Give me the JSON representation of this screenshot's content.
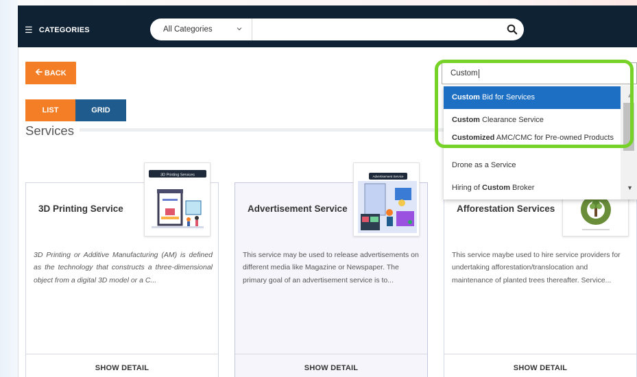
{
  "header": {
    "categories_label": "CATEGORIES",
    "category_select_value": "All Categories",
    "search_value": ""
  },
  "back_label": "BACK",
  "view_toggle": {
    "list_label": "LIST",
    "grid_label": "GRID"
  },
  "section_title": "Services",
  "autocomplete": {
    "input_value": "Custom",
    "items": [
      {
        "bold": "Custom",
        "rest": " Bid for Services"
      },
      {
        "bold": "Custom",
        "rest": " Clearance Service"
      },
      {
        "bold": "Customized",
        "rest": " AMC/CMC for Pre-owned Products"
      },
      {
        "bold": "",
        "rest": "Drone as a Service"
      },
      {
        "pre": "Hiring of ",
        "bold": "Custom",
        "rest": " Broker"
      }
    ]
  },
  "cards": [
    {
      "title": "3D Printing Service",
      "thumb_label": "3D Printing Services",
      "description": "3D Printing or Additive Manufacturing (AM) is defined as the technology that constructs a three-dimensional object from a digital 3D model or a C...",
      "action": "SHOW DETAIL"
    },
    {
      "title": "Advertisement Service",
      "thumb_label": "Advertisement Service",
      "description": "This service may be used to release advertisements on different media like Magazine or Newspaper. The primary goal of an advertisement service is to...",
      "action": "SHOW DETAIL"
    },
    {
      "title": "Afforestation Services",
      "description": "This service maybe used to hire service providers for undertaking afforestation/translocation and maintenance of planted trees thereafter. Service...",
      "action": "SHOW DETAIL"
    }
  ],
  "colors": {
    "header_bg": "#0f2233",
    "accent_orange": "#f47e25",
    "grid_blue": "#1f5b8d",
    "dropdown_active": "#1d6fc4",
    "highlight_green": "#77d227"
  }
}
